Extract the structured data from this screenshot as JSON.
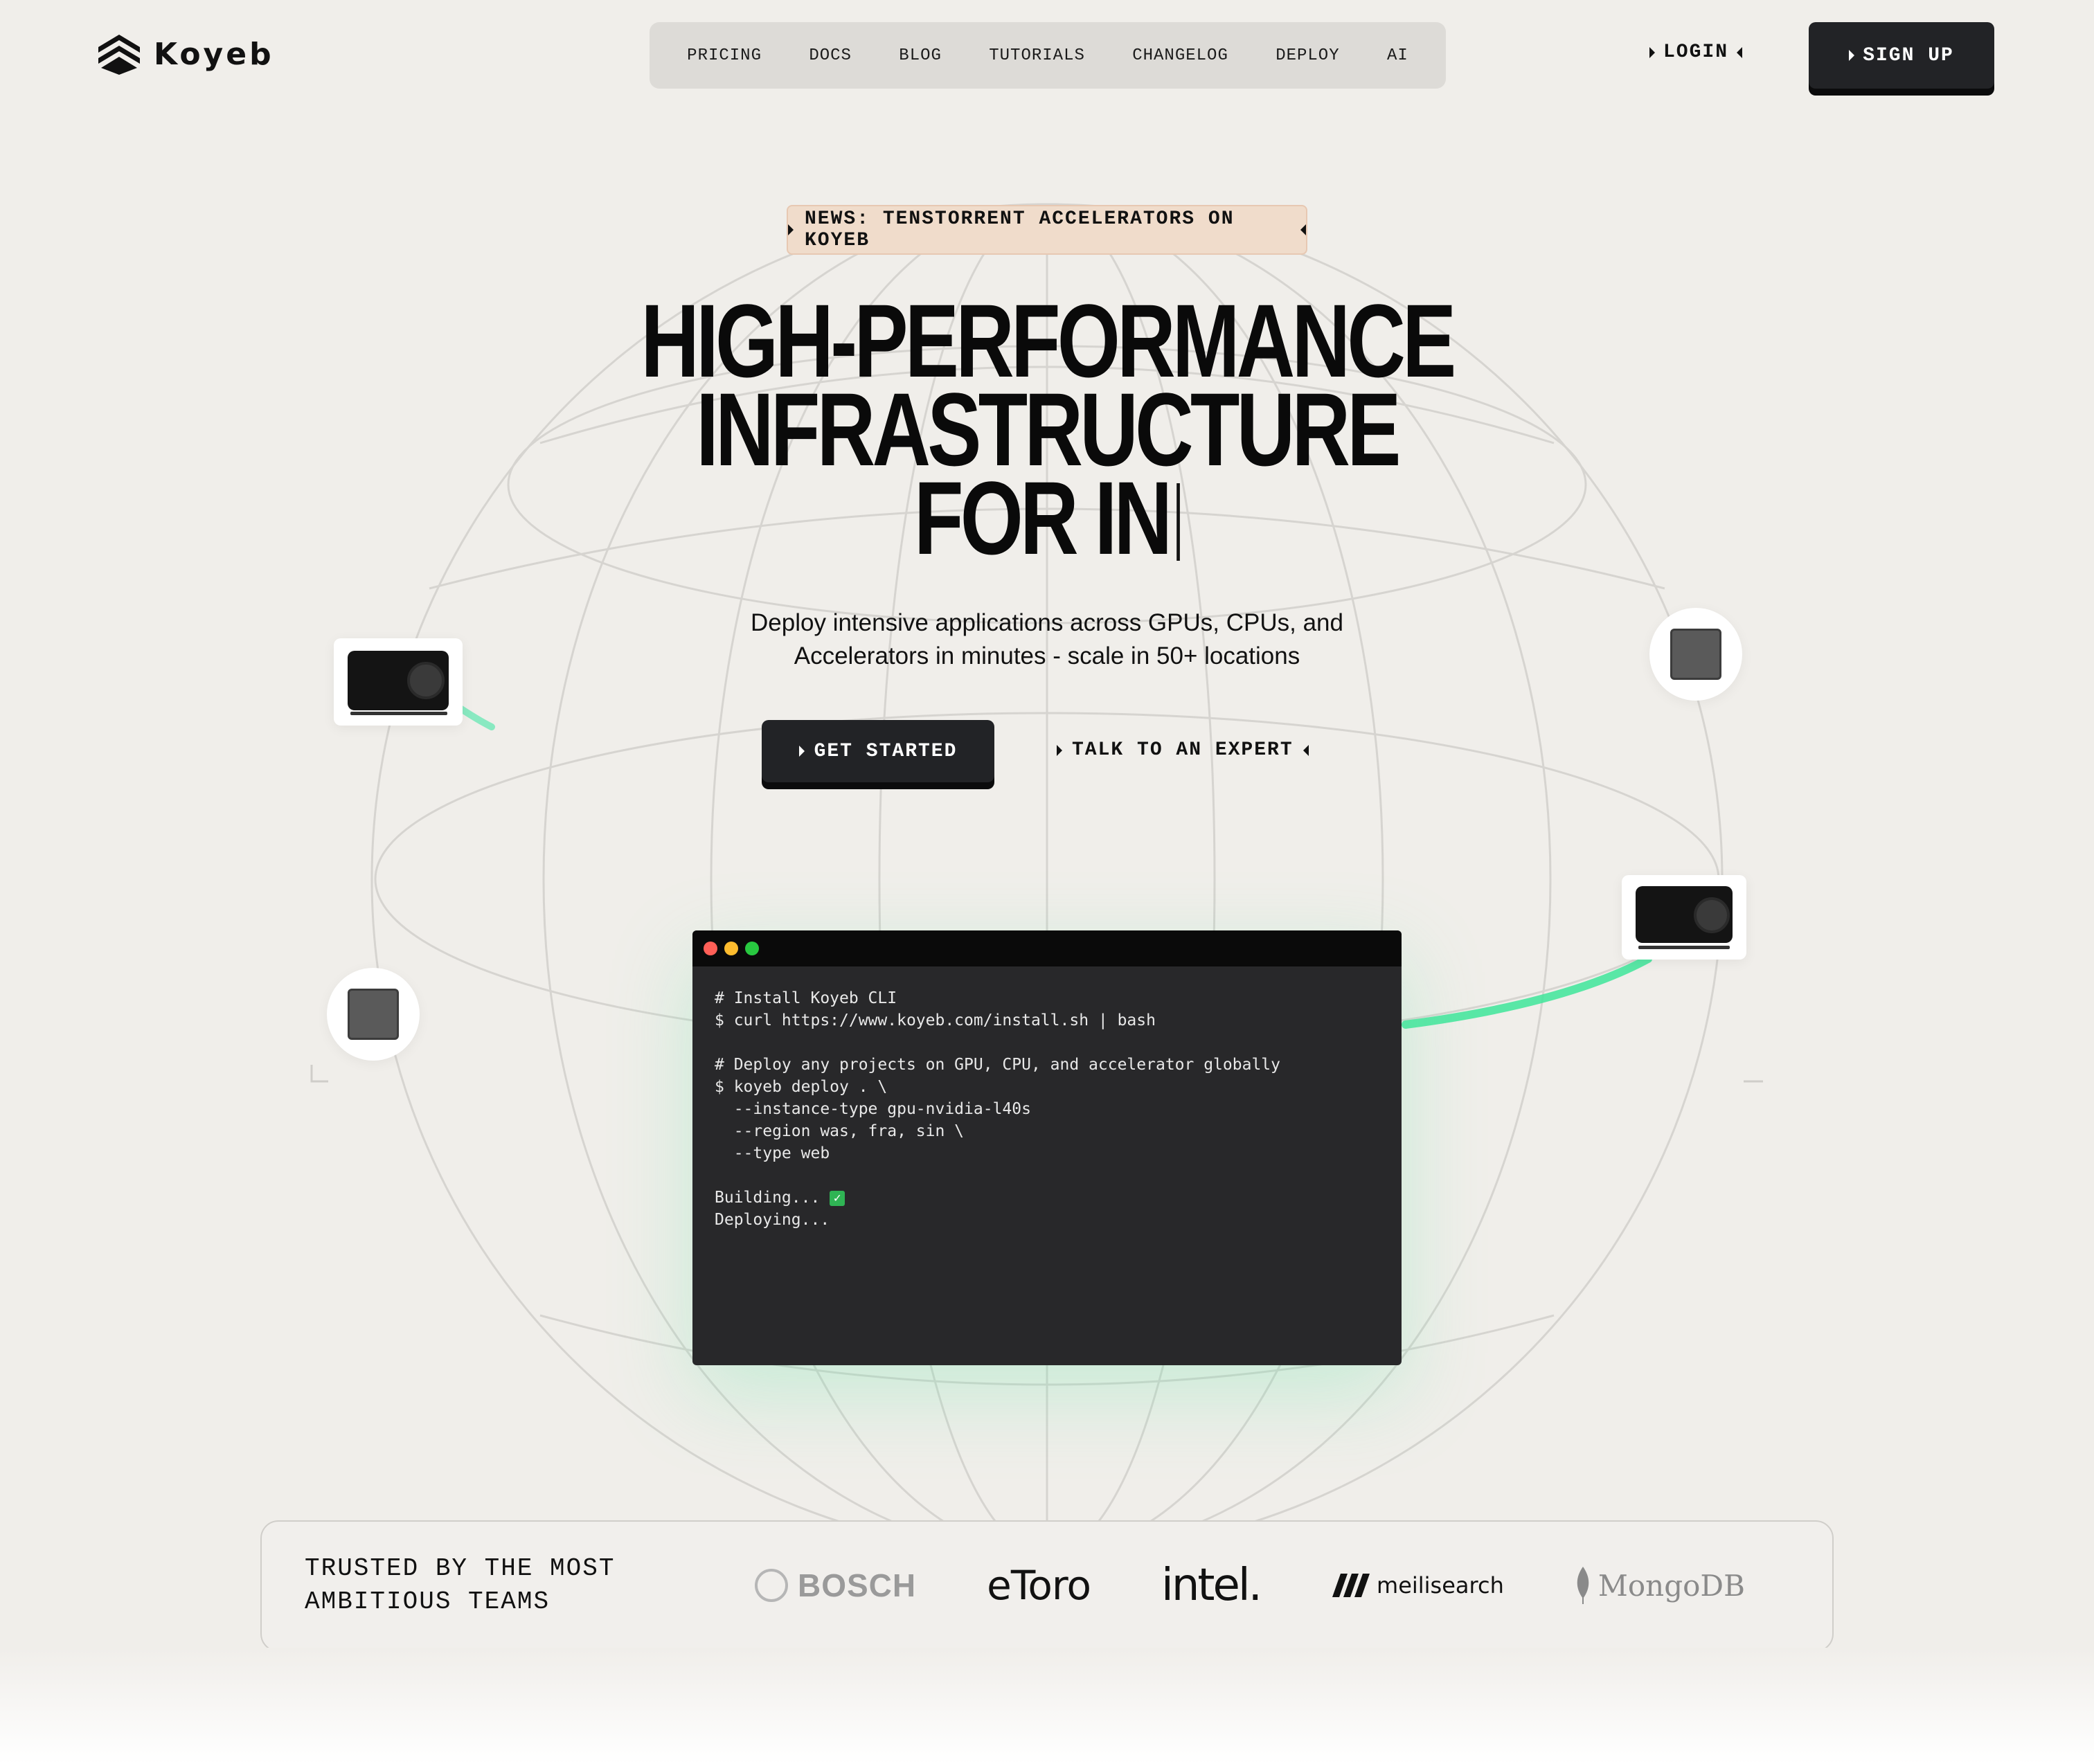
{
  "brand": {
    "name": "Koyeb",
    "logo_icon": "koyeb-logo-icon"
  },
  "nav": {
    "items": [
      {
        "label": "PRICING"
      },
      {
        "label": "DOCS"
      },
      {
        "label": "BLOG"
      },
      {
        "label": "TUTORIALS"
      },
      {
        "label": "CHANGELOG"
      },
      {
        "label": "DEPLOY"
      },
      {
        "label": "AI"
      }
    ]
  },
  "header": {
    "login_label": "LOGIN",
    "signup_label": "SIGN UP"
  },
  "news": {
    "label": "NEWS: TENSTORRENT ACCELERATORS ON KOYEB"
  },
  "hero": {
    "headline_line1": "HIGH-PERFORMANCE",
    "headline_line2": "INFRASTRUCTURE",
    "headline_line3": "FOR IN",
    "subtitle_line1": "Deploy intensive applications across GPUs, CPUs, and",
    "subtitle_line2": "Accelerators in minutes - scale in 50+ locations",
    "cta_primary": "GET STARTED",
    "cta_secondary": "TALK TO AN EXPERT"
  },
  "terminal": {
    "dots": [
      "#ff5f57",
      "#febc2e",
      "#28c840"
    ],
    "lines": [
      "# Install Koyeb CLI",
      "$ curl https://www.koyeb.com/install.sh | bash",
      "",
      "# Deploy any projects on GPU, CPU, and accelerator globally",
      "$ koyeb deploy . \\",
      "  --instance-type gpu-nvidia-l40s",
      "  --region was, fra, sin \\",
      "  --type web",
      "",
      "Building...",
      "Deploying..."
    ],
    "status_icon": "check-icon"
  },
  "trusted": {
    "title_line1": "TRUSTED BY THE MOST",
    "title_line2": "AMBITIOUS TEAMS",
    "logos": [
      "BOSCH",
      "eToro",
      "intel.",
      "meilisearch",
      "MongoDB"
    ]
  },
  "colors": {
    "accent_green": "#3ee59a",
    "dark_button": "#222326",
    "news_bg": "#f0dccb"
  }
}
